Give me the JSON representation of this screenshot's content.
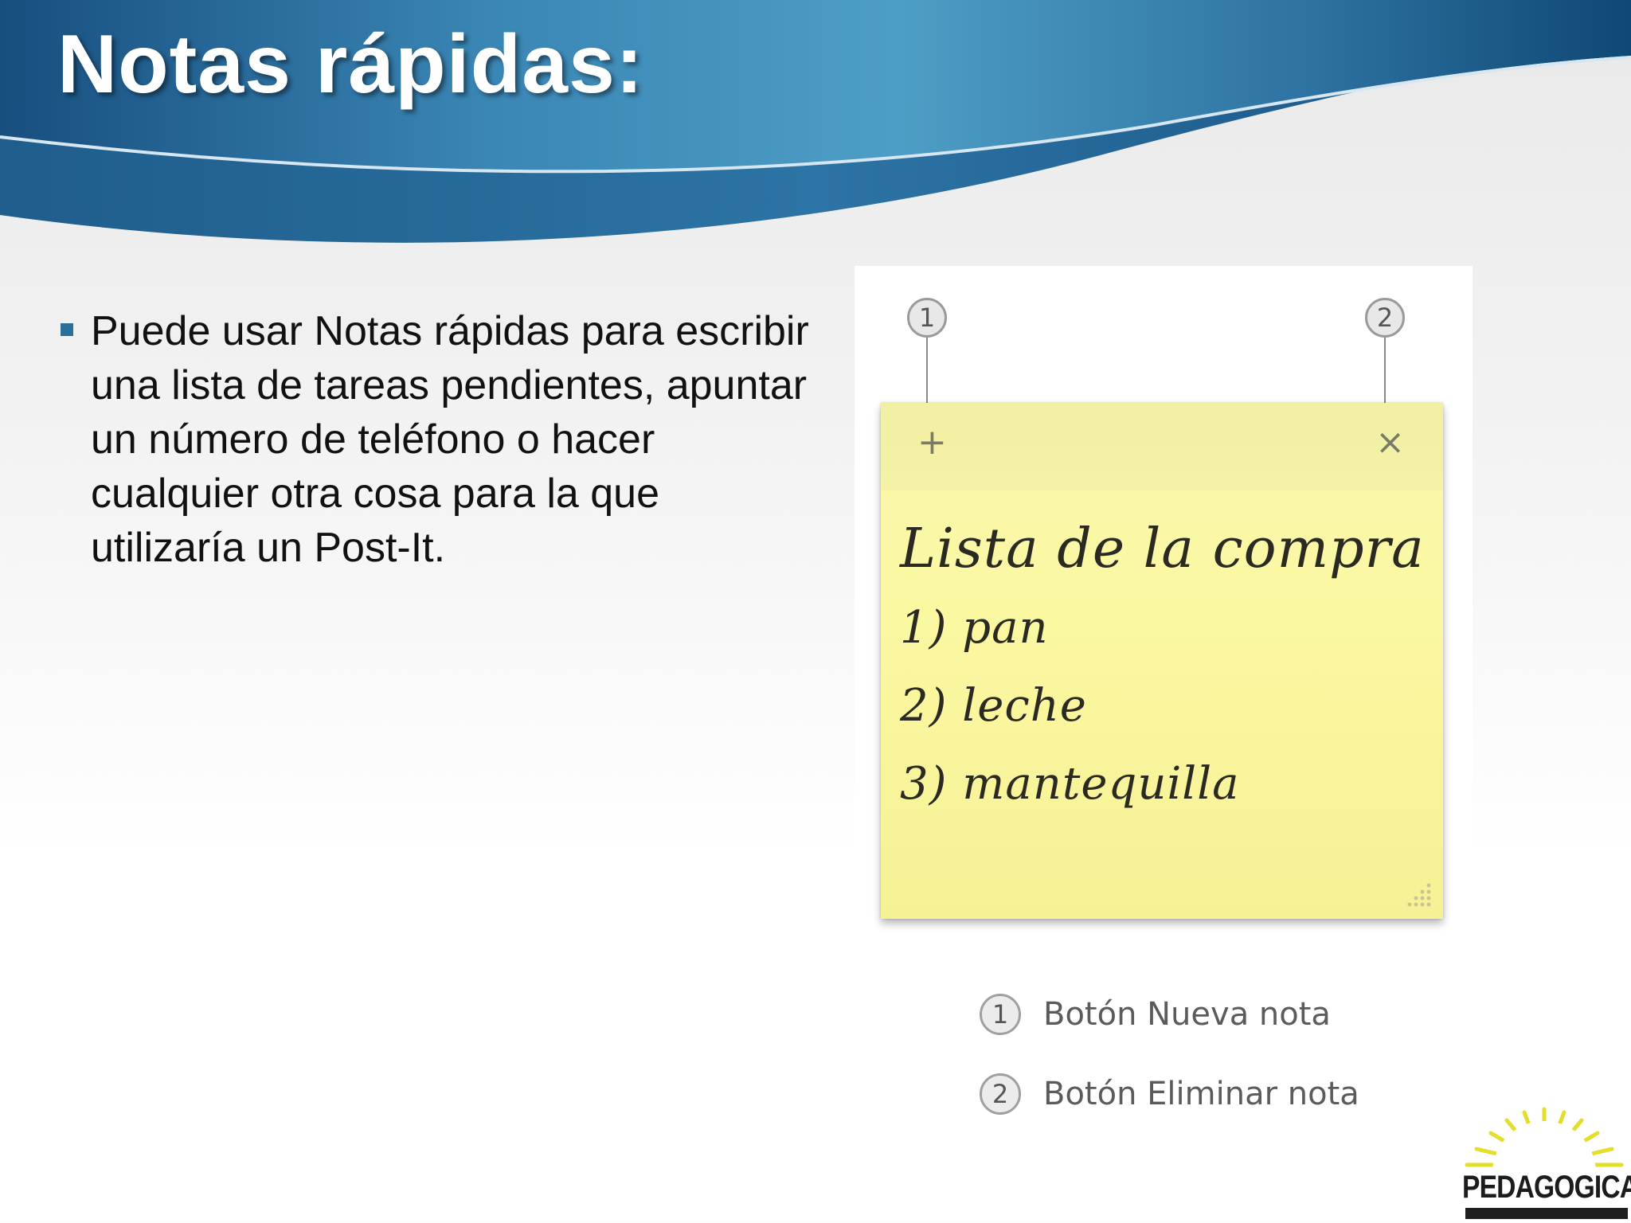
{
  "slide": {
    "title": "Notas rápidas:",
    "bullet_text": "Puede usar Notas rápidas para escribir una lista de tareas pendientes, apuntar un número de teléfono o hacer cualquier otra cosa para la que utilizaría un Post-It."
  },
  "figure": {
    "callout_1": "1",
    "callout_2": "2",
    "note": {
      "new_icon": "+",
      "delete_icon": "×",
      "title": "Lista de la compra",
      "items": [
        "1) pan",
        "2) leche",
        "3) mantequilla"
      ]
    },
    "legend": [
      {
        "num": "1",
        "label": "Botón Nueva nota"
      },
      {
        "num": "2",
        "label": "Botón Eliminar nota"
      }
    ]
  },
  "logo": {
    "name": "PEDAGOGICA"
  },
  "colors": {
    "header_dark": "#0f4f7e",
    "header_light": "#4a9cc7",
    "bullet": "#2c6e9a",
    "note_yellow": "#fbf8a2"
  }
}
